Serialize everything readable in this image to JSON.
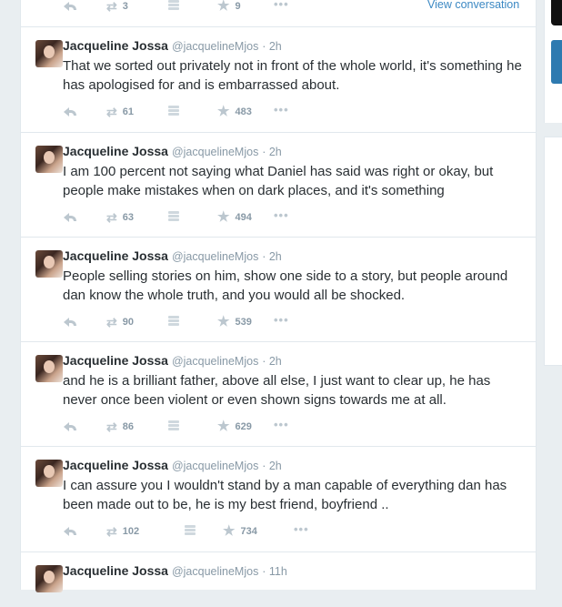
{
  "first_tweet": {
    "retweets": "3",
    "favorites": "9",
    "view_conversation": "View conversation"
  },
  "tweets": [
    {
      "name": "Jacqueline Jossa",
      "handle": "@jacquelineMjos",
      "time": "· 2h",
      "text": "That we sorted out privately not in front of the whole world, it's something he has apologised for and is embarrassed about.",
      "retweets": "61",
      "favorites": "483"
    },
    {
      "name": "Jacqueline Jossa",
      "handle": "@jacquelineMjos",
      "time": "· 2h",
      "text": "I am 100 percent not saying what Daniel has said was right or okay, but people make mistakes when on dark places, and it's something",
      "retweets": "63",
      "favorites": "494"
    },
    {
      "name": "Jacqueline Jossa",
      "handle": "@jacquelineMjos",
      "time": "· 2h",
      "text": "People selling stories on him, show one side to a story, but people around dan know the whole truth, and you would all be shocked.",
      "retweets": "90",
      "favorites": "539"
    },
    {
      "name": "Jacqueline Jossa",
      "handle": "@jacquelineMjos",
      "time": "· 2h",
      "text": "and he is a brilliant father, above all else, I just want to clear up, he has never once been violent or even shown signs towards me at all.",
      "retweets": "86",
      "favorites": "629"
    },
    {
      "name": "Jacqueline Jossa",
      "handle": "@jacquelineMjos",
      "time": "· 2h",
      "text": "I can assure you I wouldn't stand by a man capable of everything dan has been made out to be, he is my best friend, boyfriend ..",
      "retweets": "102",
      "favorites": "734"
    },
    {
      "name": "Jacqueline Jossa",
      "handle": "@jacquelineMjos",
      "time": "· 11h",
      "text": "",
      "retweets": "",
      "favorites": ""
    }
  ],
  "icons": [
    "reply-icon",
    "retweet-icon",
    "buffer-icon",
    "favorite-icon",
    "more-icon"
  ]
}
